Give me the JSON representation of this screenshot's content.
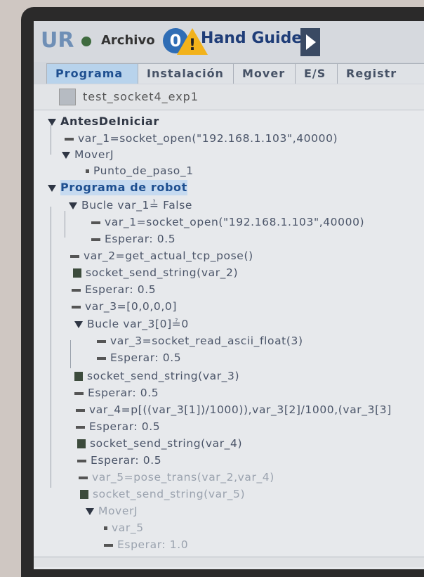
{
  "titlebar": {
    "menu_label": "Archivo",
    "mode_badge": "0",
    "mode_label": "Hand Guide"
  },
  "tabs": [
    {
      "label": "Programa",
      "active": true
    },
    {
      "label": "Instalación",
      "active": false
    },
    {
      "label": "Mover",
      "active": false
    },
    {
      "label": "E/S",
      "active": false
    },
    {
      "label": "Registr",
      "active": false
    }
  ],
  "program": {
    "name": "test_socket4_exp1"
  },
  "tree": [
    {
      "label": "AntesDeIniciar",
      "kind": "section"
    },
    {
      "label": "var_1=socket_open(\"192.168.1.103\",40000)",
      "kind": "assign"
    },
    {
      "label": "MoverJ",
      "kind": "folder"
    },
    {
      "label": "Punto_de_paso_1",
      "kind": "waypoint"
    },
    {
      "label": "Programa de robot",
      "kind": "section",
      "selected": true
    },
    {
      "label": "Bucle var_1≟ False",
      "kind": "loop"
    },
    {
      "label": "var_1=socket_open(\"192.168.1.103\",40000)",
      "kind": "assign"
    },
    {
      "label": "Esperar: 0.5",
      "kind": "assign"
    },
    {
      "label": "var_2=get_actual_tcp_pose()",
      "kind": "assign"
    },
    {
      "label": "socket_send_string(var_2)",
      "kind": "script"
    },
    {
      "label": "Esperar: 0.5",
      "kind": "assign"
    },
    {
      "label": "var_3=[0,0,0,0]",
      "kind": "assign"
    },
    {
      "label": "Bucle var_3[0]≟0",
      "kind": "loop"
    },
    {
      "label": "var_3=socket_read_ascii_float(3)",
      "kind": "assign"
    },
    {
      "label": "Esperar: 0.5",
      "kind": "assign"
    },
    {
      "label": "socket_send_string(var_3)",
      "kind": "script"
    },
    {
      "label": "Esperar: 0.5",
      "kind": "assign"
    },
    {
      "label": "var_4=p[((var_3[1])/1000)),var_3[2]/1000,(var_3[3]",
      "kind": "assign"
    },
    {
      "label": "Esperar: 0.5",
      "kind": "assign"
    },
    {
      "label": "socket_send_string(var_4)",
      "kind": "script"
    },
    {
      "label": "Esperar: 0.5",
      "kind": "assign"
    },
    {
      "label": "var_5=pose_trans(var_2,var_4)",
      "kind": "assign",
      "faded": true
    },
    {
      "label": "socket_send_string(var_5)",
      "kind": "script",
      "faded": true
    },
    {
      "label": "MoverJ",
      "kind": "folder",
      "faded": true
    },
    {
      "label": "var_5",
      "kind": "waypoint",
      "faded": true
    },
    {
      "label": "Esperar: 1.0",
      "kind": "assign",
      "faded": true
    }
  ]
}
